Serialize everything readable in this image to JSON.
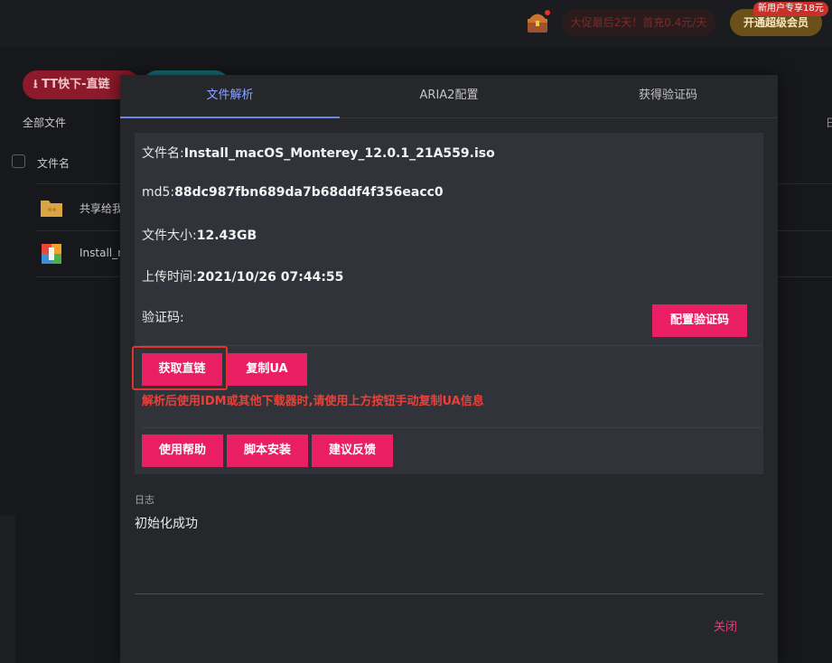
{
  "topbar": {
    "promo_text": "大促最后2天！首充0.4元/天",
    "vip_button": "开通超级会员",
    "new_user_badge": "新用户专享18元"
  },
  "toolbar": {
    "tt_download_label": "TT快下-直链"
  },
  "file_list": {
    "breadcrumb": "全部文件",
    "column_filename": "文件名",
    "rows": [
      {
        "name": "共享给我",
        "icon": "folder-icon"
      },
      {
        "name": "Install_m",
        "icon": "archive-icon"
      }
    ],
    "right_edge_text": "日"
  },
  "modal": {
    "tabs": [
      "文件解析",
      "ARIA2配置",
      "获得验证码"
    ],
    "active_tab": 0,
    "file_info": {
      "filename_label": "文件名:",
      "filename": "Install_macOS_Monterey_12.0.1_21A559.iso",
      "md5_label": "md5:",
      "md5": "88dc987fbn689da7b68ddf4f356eacc0",
      "size_label": "文件大小:",
      "size": "12.43GB",
      "upload_label": "上传时间:",
      "upload_time": "2021/10/26 07:44:55",
      "captcha_label": "验证码:"
    },
    "buttons": {
      "config_captcha": "配置验证码",
      "get_direct_link": "获取直链",
      "copy_ua": "复制UA",
      "help": "使用帮助",
      "script_install": "脚本安装",
      "feedback": "建议反馈"
    },
    "warning": "解析后使用IDM或其他下载器时,请使用上方按钮手动复制UA信息",
    "log_label": "日志",
    "log_text": "初始化成功",
    "close": "关闭"
  },
  "colors": {
    "accent_pink": "#e91e63",
    "active_tab": "#8da4ff",
    "warning_red": "#e8413a"
  }
}
